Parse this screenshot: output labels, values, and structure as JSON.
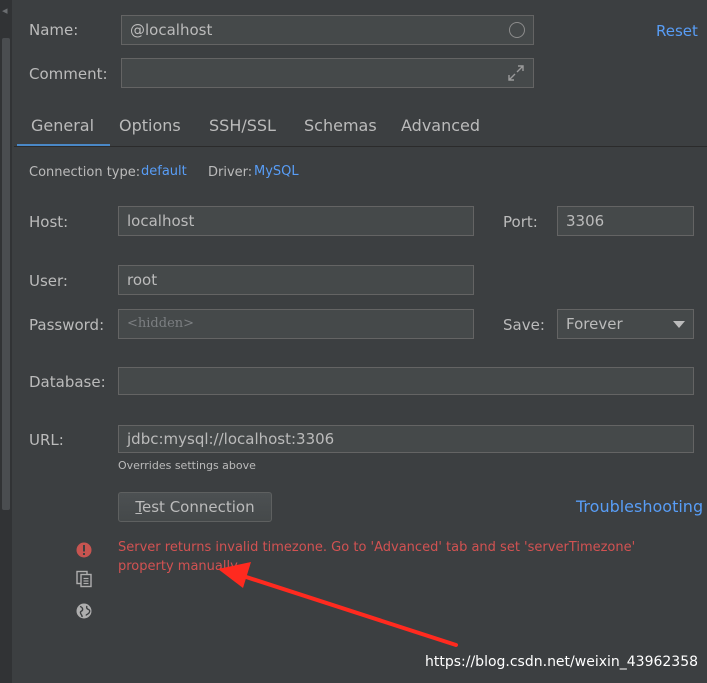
{
  "header": {
    "name_label": "Name:",
    "name_value": "@localhost",
    "comment_label": "Comment:",
    "comment_value": "",
    "reset_link": "Reset"
  },
  "tabs": [
    {
      "label": "General",
      "active": true
    },
    {
      "label": "Options",
      "active": false
    },
    {
      "label": "SSH/SSL",
      "active": false
    },
    {
      "label": "Schemas",
      "active": false
    },
    {
      "label": "Advanced",
      "active": false
    }
  ],
  "connection": {
    "type_label": "Connection type:",
    "type_value": "default",
    "driver_label": "Driver:",
    "driver_value": "MySQL"
  },
  "form": {
    "host_label": "Host:",
    "host_value": "localhost",
    "port_label": "Port:",
    "port_value": "3306",
    "user_label": "User:",
    "user_value": "root",
    "password_label": "Password:",
    "password_placeholder": "<hidden>",
    "save_label": "Save:",
    "save_value": "Forever",
    "database_label": "Database:",
    "database_value": "",
    "url_label": "URL:",
    "url_value": "jdbc:mysql://localhost:3306",
    "url_hint": "Overrides settings above"
  },
  "actions": {
    "test_connection_mnemonic": "T",
    "test_connection_rest": "est Connection",
    "troubleshooting_link": "Troubleshooting"
  },
  "error": {
    "message": "Server returns invalid timezone. Go to 'Advanced' tab and set 'serverTimezone' property manually."
  },
  "icons": {
    "error": "error-icon",
    "copy": "copy-icon",
    "globe": "globe-icon"
  },
  "watermark": "https://blog.csdn.net/weixin_43962358",
  "colors": {
    "background": "#3c3f41",
    "field_bg": "#45494a",
    "link": "#589df6",
    "error": "#d25252",
    "tab_underline": "#4a88c7",
    "annotation_arrow": "#ff2a1f"
  }
}
